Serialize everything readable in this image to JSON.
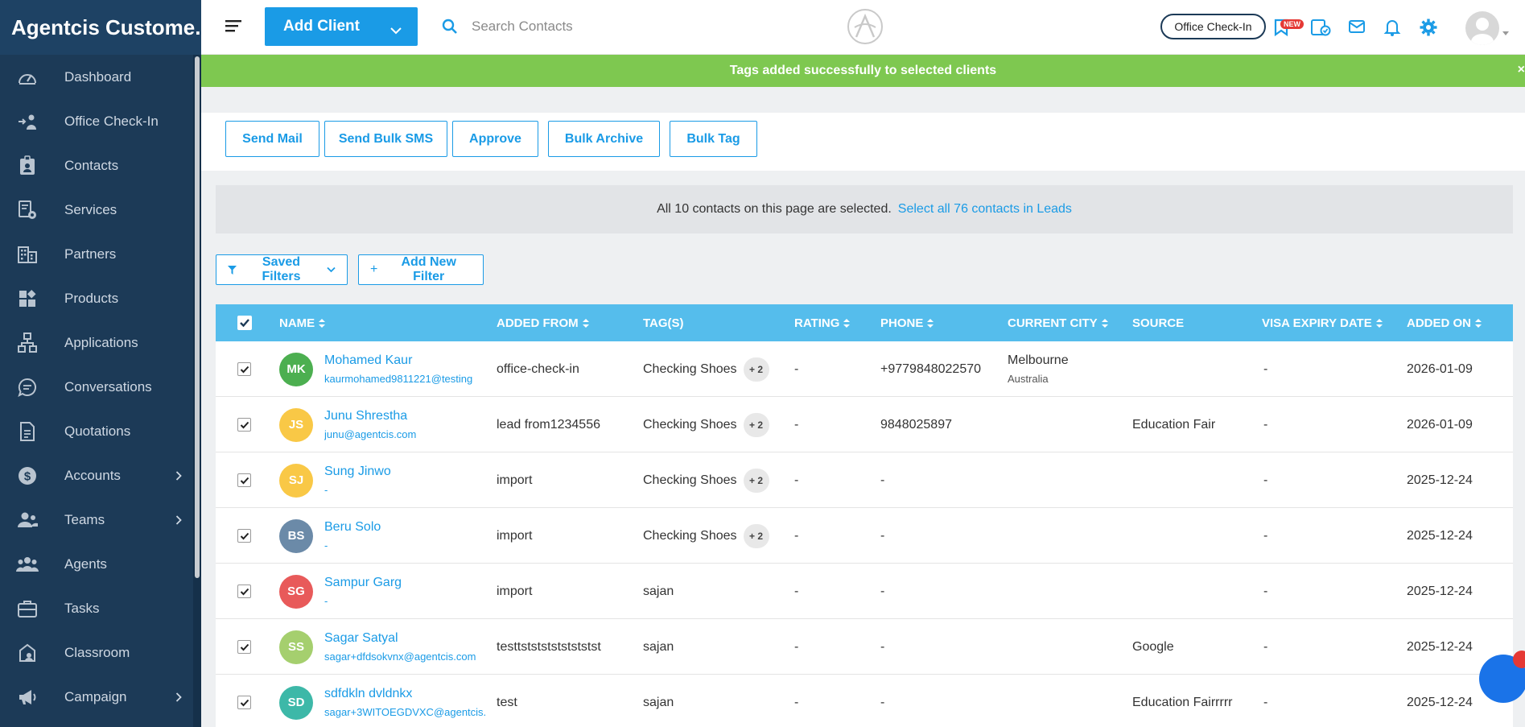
{
  "app": {
    "title": "Agentcis Custome..."
  },
  "sidebar": {
    "items": [
      {
        "label": "Dashboard",
        "icon": "gauge-icon",
        "has_chevron": false
      },
      {
        "label": "Office Check-In",
        "icon": "office-checkin-icon",
        "has_chevron": false
      },
      {
        "label": "Contacts",
        "icon": "contact-badge-icon",
        "has_chevron": false
      },
      {
        "label": "Services",
        "icon": "services-icon",
        "has_chevron": false
      },
      {
        "label": "Partners",
        "icon": "building-icon",
        "has_chevron": false
      },
      {
        "label": "Products",
        "icon": "products-icon",
        "has_chevron": false
      },
      {
        "label": "Applications",
        "icon": "flowchart-icon",
        "has_chevron": false
      },
      {
        "label": "Conversations",
        "icon": "chat-bubble-icon",
        "has_chevron": false
      },
      {
        "label": "Quotations",
        "icon": "document-icon",
        "has_chevron": false
      },
      {
        "label": "Accounts",
        "icon": "dollar-icon",
        "has_chevron": true
      },
      {
        "label": "Teams",
        "icon": "team-icon",
        "has_chevron": true
      },
      {
        "label": "Agents",
        "icon": "agents-icon",
        "has_chevron": false
      },
      {
        "label": "Tasks",
        "icon": "briefcase-icon",
        "has_chevron": false
      },
      {
        "label": "Classroom",
        "icon": "classroom-icon",
        "has_chevron": false
      },
      {
        "label": "Campaign",
        "icon": "megaphone-icon",
        "has_chevron": true
      }
    ]
  },
  "header": {
    "add_client_label": "Add Client",
    "search_placeholder": "Search Contacts",
    "office_checkin_label": "Office Check-In",
    "new_badge": "NEW"
  },
  "toast": {
    "message": "Tags added successfully to selected clients",
    "close": "×"
  },
  "actions": {
    "send_mail": "Send Mail",
    "send_bulk_sms": "Send Bulk SMS",
    "approve": "Approve",
    "bulk_archive": "Bulk Archive",
    "bulk_tag": "Bulk Tag"
  },
  "selection_banner": {
    "text": "All 10 contacts on this page are selected.",
    "link": "Select all 76 contacts in Leads"
  },
  "filters": {
    "saved_filters": "Saved Filters",
    "add_new_filter": "Add New Filter"
  },
  "table": {
    "columns": {
      "name": "NAME",
      "added_from": "ADDED FROM",
      "tags": "TAG(S)",
      "rating": "RATING",
      "phone": "PHONE",
      "current_city": "CURRENT CITY",
      "source": "SOURCE",
      "visa_expiry_date": "VISA EXPIRY DATE",
      "added_on": "ADDED ON"
    },
    "rows": [
      {
        "initials": "MK",
        "color": "#4caf50",
        "name": "Mohamed Kaur",
        "email": "kaurmohamed9811221@testing",
        "added_from": "office-check-in",
        "tag": "Checking Shoes",
        "tag_extra": "+ 2",
        "rating": "-",
        "phone": "+9779848022570",
        "city": "Melbourne",
        "country": "Australia",
        "source": "",
        "visa": "-",
        "added_on": "2026-01-09"
      },
      {
        "initials": "JS",
        "color": "#f9c846",
        "name": "Junu Shrestha",
        "email": "junu@agentcis.com",
        "added_from": "lead from1234556",
        "tag": "Checking Shoes",
        "tag_extra": "+ 2",
        "rating": "-",
        "phone": "9848025897",
        "city": "",
        "country": "",
        "source": "Education Fair",
        "visa": "-",
        "added_on": "2026-01-09"
      },
      {
        "initials": "SJ",
        "color": "#f9c846",
        "name": "Sung Jinwo",
        "email": "-",
        "added_from": "import",
        "tag": "Checking Shoes",
        "tag_extra": "+ 2",
        "rating": "-",
        "phone": "-",
        "city": "",
        "country": "",
        "source": "",
        "visa": "-",
        "added_on": "2025-12-24"
      },
      {
        "initials": "BS",
        "color": "#6b8aa8",
        "name": "Beru Solo",
        "email": "-",
        "added_from": "import",
        "tag": "Checking Shoes",
        "tag_extra": "+ 2",
        "rating": "-",
        "phone": "-",
        "city": "",
        "country": "",
        "source": "",
        "visa": "-",
        "added_on": "2025-12-24"
      },
      {
        "initials": "SG",
        "color": "#e85a5a",
        "name": "Sampur Garg",
        "email": "-",
        "added_from": "import",
        "tag": "sajan",
        "tag_extra": "",
        "rating": "-",
        "phone": "-",
        "city": "",
        "country": "",
        "source": "",
        "visa": "-",
        "added_on": "2025-12-24"
      },
      {
        "initials": "SS",
        "color": "#a5cf6e",
        "name": "Sagar Satyal",
        "email": "sagar+dfdsokvnx@agentcis.com",
        "added_from": "testtstststststststst",
        "tag": "sajan",
        "tag_extra": "",
        "rating": "-",
        "phone": "-",
        "city": "",
        "country": "",
        "source": "Google",
        "visa": "-",
        "added_on": "2025-12-24"
      },
      {
        "initials": "SD",
        "color": "#3db8a8",
        "name": "sdfdkln dvldnkx",
        "email": "sagar+3WITOEGDVXC@agentcis.",
        "added_from": "test",
        "tag": "sajan",
        "tag_extra": "",
        "rating": "-",
        "phone": "-",
        "city": "",
        "country": "",
        "source": "Education Fairrrrr",
        "visa": "-",
        "added_on": "2025-12-24"
      }
    ]
  },
  "colors": {
    "sidebar": "#1c3a57",
    "primary": "#1a9be6",
    "table_header": "#55bdec",
    "toast": "#7ec850"
  }
}
